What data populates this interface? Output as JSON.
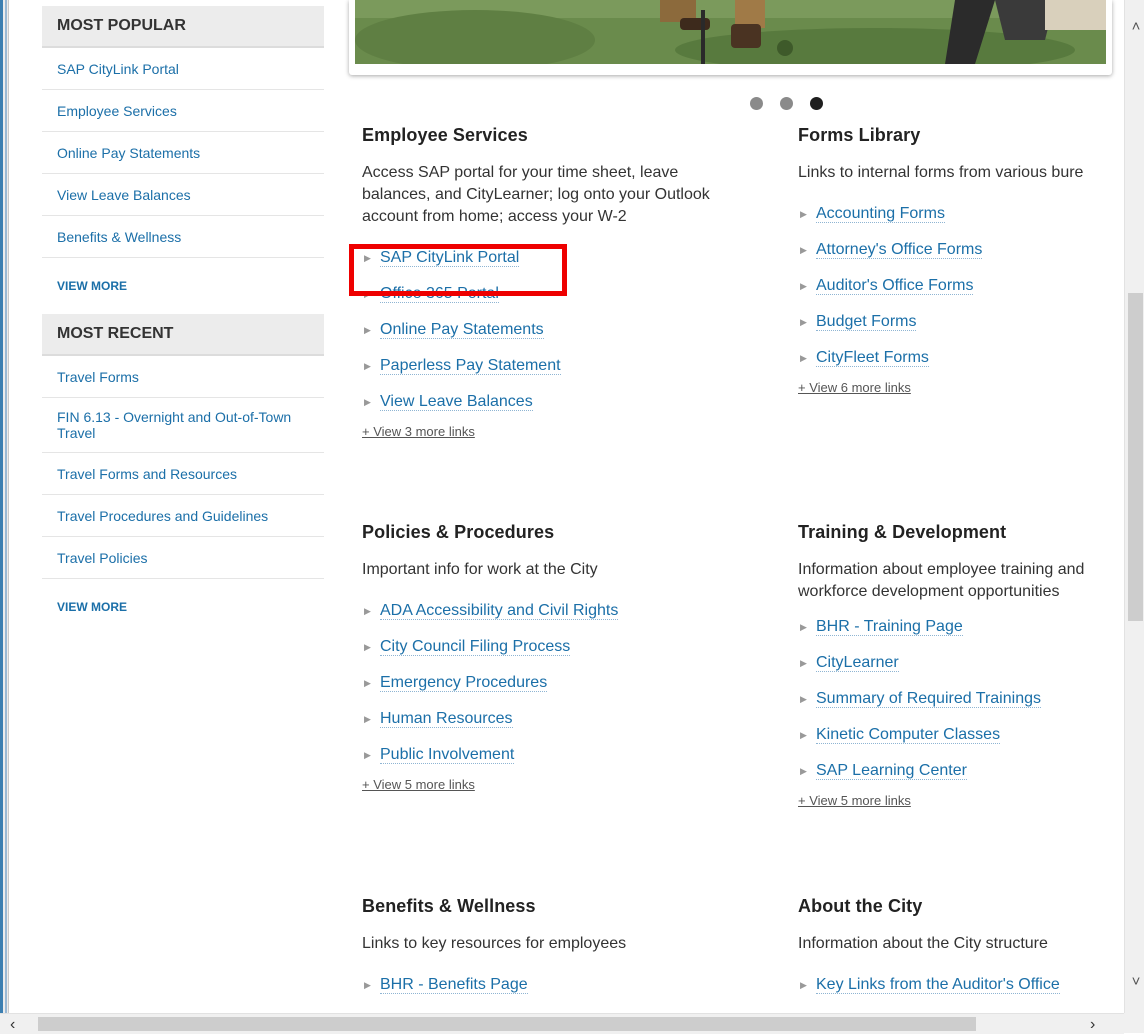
{
  "sidebar": {
    "popular": {
      "heading": "MOST POPULAR",
      "items": [
        "SAP CityLink Portal",
        "Employee Services",
        "Online Pay Statements",
        "View Leave Balances",
        "Benefits & Wellness"
      ],
      "view_more": "VIEW MORE"
    },
    "recent": {
      "heading": "MOST RECENT",
      "items": [
        "Travel Forms",
        "FIN 6.13 - Overnight and Out-of-Town Travel",
        "Travel Forms and Resources",
        "Travel Procedures and Guidelines",
        "Travel Policies"
      ],
      "view_more": "VIEW MORE"
    }
  },
  "carousel": {
    "active_index": 2,
    "count": 3
  },
  "sections": {
    "employee_services": {
      "title": "Employee Services",
      "description": "Access SAP portal for your time sheet, leave balances, and CityLearner; log onto your Outlook account from home; access your W-2",
      "links": [
        "SAP CityLink Portal",
        "Office 365 Portal",
        "Online Pay Statements",
        "Paperless Pay Statement",
        "View Leave Balances"
      ],
      "more": "+ View 3 more links"
    },
    "forms_library": {
      "title": "Forms Library",
      "description": "Links to internal forms from various bure",
      "links": [
        "Accounting Forms",
        "Attorney's Office Forms",
        "Auditor's Office Forms",
        "Budget Forms",
        "CityFleet Forms"
      ],
      "more": "+ View 6 more links"
    },
    "policies": {
      "title": "Policies & Procedures",
      "description": "Important info for work at the City",
      "links": [
        "ADA Accessibility and Civil Rights",
        "City Council Filing Process",
        "Emergency Procedures",
        "Human Resources",
        "Public Involvement"
      ],
      "more": "+ View 5 more links"
    },
    "training": {
      "title": "Training & Development",
      "description": "Information about employee training and workforce development opportunities",
      "links": [
        "BHR - Training Page",
        "CityLearner",
        "Summary of Required Trainings",
        "Kinetic Computer Classes",
        "SAP Learning Center"
      ],
      "more": "+ View 5 more links"
    },
    "benefits": {
      "title": "Benefits & Wellness",
      "description": "Links to key resources for employees",
      "links": [
        "BHR - Benefits Page"
      ]
    },
    "about": {
      "title": "About the City",
      "description": "Information about the City structure",
      "links": [
        "Key Links from the Auditor's Office"
      ]
    }
  },
  "colors": {
    "link": "#1b6fa8",
    "highlight": "#ee0000"
  },
  "icons": {
    "scroll_up": "chevron-up-icon",
    "scroll_down": "chevron-down-icon",
    "scroll_left": "chevron-left-icon",
    "scroll_right": "chevron-right-icon",
    "bullet": "triangle-right-icon"
  }
}
